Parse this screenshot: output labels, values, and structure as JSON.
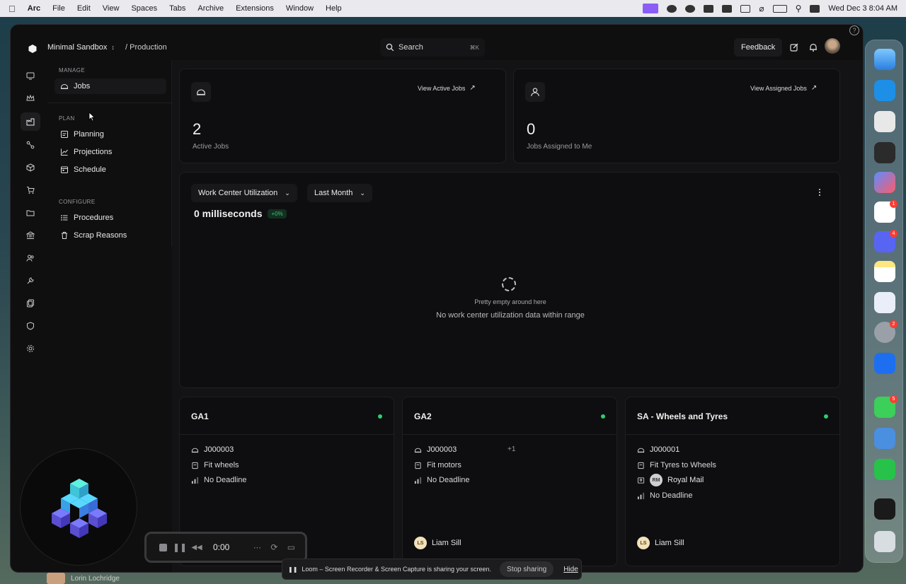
{
  "menubar": {
    "app": "Arc",
    "items": [
      "File",
      "Edit",
      "View",
      "Spaces",
      "Tabs",
      "Archive",
      "Extensions",
      "Window",
      "Help"
    ],
    "clock": "Wed Dec 3  8:04 AM"
  },
  "topbar": {
    "org": "Minimal Sandbox",
    "breadcrumb": "/ Production",
    "search_label": "Search",
    "search_shortcut": "⌘K",
    "feedback_label": "Feedback"
  },
  "rail": {
    "icons": [
      "monitor-icon",
      "crown-icon",
      "factory-icon",
      "share-nodes-icon",
      "cube-icon",
      "cart-icon",
      "folder-icon",
      "bank-icon",
      "users-icon",
      "wrench-icon",
      "copy-icon",
      "shield-icon",
      "gear-icon"
    ],
    "active_index": 2
  },
  "subnav": {
    "manage_heading": "MANAGE",
    "jobs": "Jobs",
    "plan_heading": "PLAN",
    "planning": "Planning",
    "projections": "Projections",
    "schedule": "Schedule",
    "configure_heading": "CONFIGURE",
    "procedures": "Procedures",
    "scrap_reasons": "Scrap Reasons"
  },
  "stats": {
    "active": {
      "link": "View Active Jobs",
      "value": "2",
      "label": "Active Jobs"
    },
    "assigned": {
      "link": "View Assigned Jobs",
      "value": "0",
      "label": "Jobs Assigned to Me"
    }
  },
  "utilization": {
    "metric_select": "Work Center Utilization",
    "range_select": "Last Month",
    "value": "0 milliseconds",
    "change": "+0%",
    "empty_title": "Pretty empty around here",
    "empty_desc": "No work center utilization data within range"
  },
  "work_centers": [
    {
      "name": "GA1",
      "job": "J000003",
      "extra": "",
      "task": "Fit wheels",
      "customer": "",
      "deadline": "No Deadline",
      "assignee": "",
      "assignee_initials": ""
    },
    {
      "name": "GA2",
      "job": "J000003",
      "extra": "+1",
      "task": "Fit motors",
      "customer": "",
      "deadline": "No Deadline",
      "assignee": "Liam Sill",
      "assignee_initials": "LS"
    },
    {
      "name": "SA - Wheels and Tyres",
      "job": "J000001",
      "extra": "",
      "task": "Fit Tyres to Wheels",
      "customer": "Royal Mail",
      "customer_initials": "RM",
      "deadline": "No Deadline",
      "assignee": "Liam Sill",
      "assignee_initials": "LS"
    }
  ],
  "recorder": {
    "time": "0:00"
  },
  "share_bar": {
    "message": "Loom – Screen Recorder & Screen Capture is sharing your screen.",
    "stop_label": "Stop sharing",
    "hide_label": "Hide"
  },
  "user_strip": {
    "name": "Lorin Lochridge"
  },
  "dock": {
    "badges": {
      "slack": "1",
      "discord": "4",
      "system-settings": "2",
      "messages": "5"
    }
  },
  "colors": {
    "accent_green": "#2ecc71",
    "background": "#0f0f10"
  }
}
